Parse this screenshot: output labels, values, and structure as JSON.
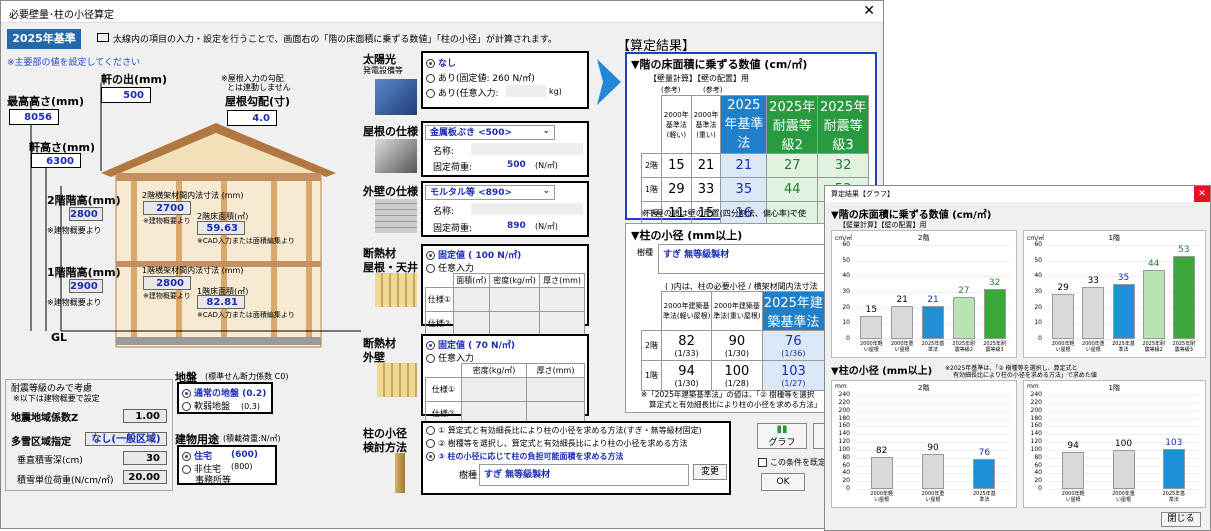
{
  "main": {
    "title": "必要壁量･柱の小径算定",
    "badge": "2025年基準",
    "instruction": "太線内の項目の入力・設定を行うことで、画面右の「階の床面積に乗ずる数値」「柱の小径」が計算されます。",
    "note": "※主要部の値を設定してください",
    "eave": {
      "label": "軒の出(mm)",
      "value": "500"
    },
    "max_height": {
      "label": "最高高さ(mm)",
      "value": "8056"
    },
    "roof_pitch": {
      "note1": "※屋根入力の勾配",
      "note2": "とは連動しません",
      "label": "屋根勾配(寸)",
      "value": "4.0"
    },
    "eave_height": {
      "label": "軒高さ(mm)",
      "value": "6300"
    },
    "floor2": {
      "label": "2階階高(mm)",
      "value": "2800",
      "note": "※建物概要より",
      "col_label": "2階横架材間内法寸法 (mm)",
      "col_value": "2700",
      "col_note": "※建物概要より",
      "area_label": "2階床面積(㎡)",
      "area_value": "59.63",
      "area_note": "※CAD入力または面積編集より"
    },
    "floor1": {
      "label": "1階階高(mm)",
      "value": "2900",
      "note": "※建物概要より",
      "col_label": "1階横架材間内法寸法 (mm)",
      "col_value": "2800",
      "col_note": "※建物概要より",
      "area_label": "1階床面積(㎡)",
      "area_value": "82.81",
      "area_note": "※CAD入力または面積編集より"
    },
    "gl": "GL",
    "seismic": {
      "title": "耐震等級のみで考慮",
      "note": "※以下は建物概要で設定",
      "zone_label": "地震地域係数Z",
      "zone_value": "1.00",
      "snow_label": "多雪区域指定",
      "snow_value": "なし(一般区域)",
      "depth_label": "垂直積雪深(cm)",
      "depth_value": "30",
      "unit_label": "積雪単位荷重(N/cm/㎡)",
      "unit_value": "20.00"
    },
    "ground": {
      "label": "地盤",
      "sub": "(標準せん断力係数 C0)",
      "opt1": "通常の地盤 (0.2)",
      "opt2": "軟弱地盤",
      "opt2_val": "(0.3)"
    },
    "usage": {
      "label": "建物用途",
      "sub": "(積載荷重:N/㎡)",
      "opt1": "住宅",
      "opt1_val": "(600)",
      "opt2": "非住宅",
      "opt2_val": "(800)",
      "opt2b": "事務所等"
    },
    "solar": {
      "label": "太陽光",
      "sub": "発電設備等",
      "opt1": "なし",
      "opt2": "あり(固定値: 260 N/㎡)",
      "opt3": "あり(任意入力:",
      "opt3_unit": "kg)"
    },
    "roof": {
      "label": "屋根の仕様",
      "combo": "金属板ぶき <500>",
      "name_label": "名称:",
      "load_label": "固定荷重:",
      "load_value": "500",
      "unit": "(N/㎡)"
    },
    "wall": {
      "label": "外壁の仕様",
      "combo": "モルタル等 <890>",
      "name_label": "名称:",
      "load_label": "固定荷重:",
      "load_value": "890",
      "unit": "(N/㎡)"
    },
    "ins_roof": {
      "label1": "断熱材",
      "label2": "屋根・天井",
      "opt1": "固定値 ( 100 N/㎡)",
      "opt2": "任意入力",
      "h1": "面積(㎡)",
      "h2": "密度(kg/㎥)",
      "h3": "厚さ(mm)",
      "r1": "仕様①",
      "r2": "仕様②"
    },
    "ins_wall": {
      "label1": "断熱材",
      "label2": "外壁",
      "opt1": "固定値 ( 70 N/㎡)",
      "opt2": "任意入力",
      "h2": "密度(kg/㎥)",
      "h3": "厚さ(mm)",
      "r1": "仕様①",
      "r2": "仕様②"
    },
    "column": {
      "label1": "柱の小径",
      "label2": "検討方法",
      "opt1": "① 算定式と有効細長比により柱の小径を求める方法(すぎ・無等級材固定)",
      "opt2": "② 樹種等を選択し、算定式と有効細長比により柱の小径を求める方法",
      "opt3": "③ 柱の小径に応じて柱の負担可能面積を求める方法",
      "species_label": "樹種",
      "species_value": "すぎ 無等級製材",
      "change_btn": "変更"
    },
    "result": {
      "title": "【算定結果】",
      "floor_title": "▼階の床面積に乗ずる数値 (cm/㎡)",
      "floor_sub": "【壁量計算】【壁の配置】用",
      "ref1": "(参考)",
      "ref2": "(参考)",
      "headers": [
        "2000年基準法(軽い)",
        "2000年基準法(重い)",
        "2025年基準法",
        "2025年耐震等級2",
        "2025年耐震等級3"
      ],
      "rows": [
        {
          "label": "2階",
          "values": [
            "15",
            "21",
            "21",
            "27",
            "32"
          ]
        },
        {
          "label": "1階",
          "values": [
            "29",
            "33",
            "35",
            "44",
            "53"
          ]
        },
        {
          "label": "下屋",
          "values": [
            "11",
            "15",
            "16",
            "-",
            ""
          ]
        }
      ],
      "floor_note": "※下屋の値は壁の配置(四分割法、偏心率)で使",
      "col_title": "▼柱の小径 (mm以上)",
      "species_label": "樹種",
      "species_value": "すぎ 無等級製材",
      "col_note": "( )内は、柱の必要小径 / 横架材間内法寸法",
      "col_headers": [
        "2000年建築基準法(軽い屋根)",
        "2000年建築基準法(重い屋根)",
        "2025年建築基準法"
      ],
      "col_rows": [
        {
          "label": "2階",
          "values": [
            "82",
            "90",
            "76"
          ],
          "ratios": [
            "(1/33)",
            "(1/30)",
            "(1/36)"
          ]
        },
        {
          "label": "1階",
          "values": [
            "94",
            "100",
            "103"
          ],
          "ratios": [
            "(1/30)",
            "(1/28)",
            "(1/27)"
          ]
        }
      ],
      "foot1": "※「2025年建築基準法」の値は、「② 樹種等を選択",
      "foot2": "算定式と有効細長比により柱の小径を求める方法」",
      "graph_btn": "グラフ",
      "check_label": "この条件を既定",
      "ok": "OK"
    }
  },
  "graph": {
    "title": "算定結果【グラフ】",
    "floor_title": "▼階の床面積に乗ずる数値 (cm/㎡)",
    "floor_sub": "【壁量計算】【壁の配置】用",
    "col_title": "▼柱の小径 (mm以上)",
    "col_note1": "※2025年基準は、「② 樹種等を選択し、算定式と",
    "col_note2": "有効細長比により柱の小径を求める方法」で求めた値",
    "close": "閉じる",
    "colors": {
      "gray": "#d9d9d9",
      "blue": "#1f8fd8",
      "lightgreen": "#b9e3b0",
      "green": "#3aa83a"
    }
  },
  "chart_data": [
    {
      "type": "bar",
      "title": "2階",
      "ylabel": "cm/㎡",
      "ylim": [
        0,
        60
      ],
      "categories": [
        "2000年軽い屋根",
        "2000年重い屋根",
        "2025年基準法",
        "2025年耐震等級2",
        "2025年耐震等級3"
      ],
      "values": [
        15,
        21,
        21,
        27,
        32
      ]
    },
    {
      "type": "bar",
      "title": "1階",
      "ylabel": "cm/㎡",
      "ylim": [
        0,
        60
      ],
      "categories": [
        "2000年軽い屋根",
        "2000年重い屋根",
        "2025年基準法",
        "2025年耐震等級2",
        "2025年耐震等級3"
      ],
      "values": [
        29,
        33,
        35,
        44,
        53
      ]
    },
    {
      "type": "bar",
      "title": "2階",
      "ylabel": "mm",
      "ylim": [
        0,
        240
      ],
      "categories": [
        "2000年軽い屋根",
        "2000年重い屋根",
        "2025年基準法"
      ],
      "values": [
        82,
        90,
        76
      ]
    },
    {
      "type": "bar",
      "title": "1階",
      "ylabel": "mm",
      "ylim": [
        0,
        240
      ],
      "categories": [
        "2000年軽い屋根",
        "2000年重い屋根",
        "2025年基準法"
      ],
      "values": [
        94,
        100,
        103
      ]
    }
  ]
}
